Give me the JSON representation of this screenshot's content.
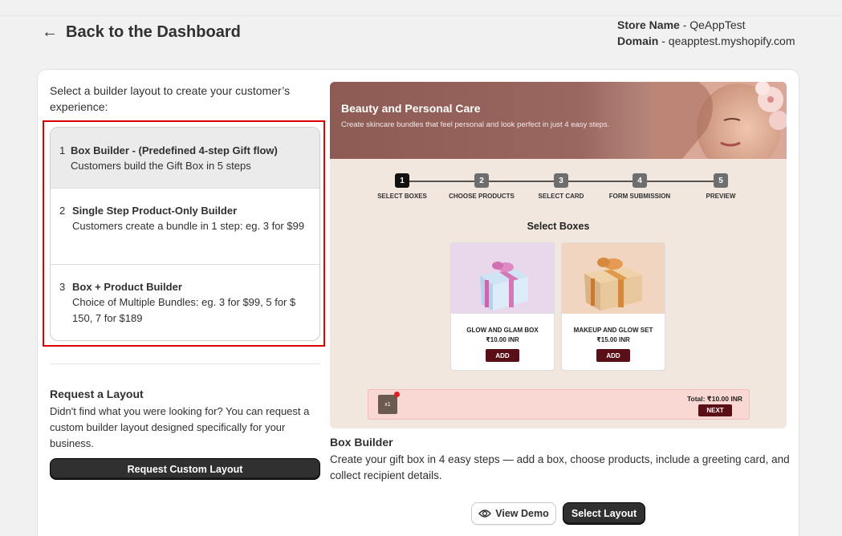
{
  "header": {
    "back_label": "Back to the Dashboard",
    "store_name_label": "Store Name",
    "store_name_value": " - QeAppTest",
    "domain_label": "Domain",
    "domain_value": " - qeapptest.myshopify.com"
  },
  "left": {
    "intro": "Select a builder layout to create your customer’s experience:",
    "options": [
      {
        "num": "1",
        "title": "Box Builder - (Predefined 4-step Gift flow)",
        "desc": "Customers build the Gift Box in 5 steps",
        "selected": true
      },
      {
        "num": "2",
        "title": "Single Step Product-Only Builder",
        "desc": "Customers create a bundle in 1 step: eg. 3 for $99",
        "selected": false
      },
      {
        "num": "3",
        "title": "Box + Product Builder",
        "desc": "Choice of Multiple Bundles: eg. 3 for $99, 5 for $ 150, 7 for $189",
        "selected": false
      }
    ],
    "request": {
      "title": "Request a Layout",
      "desc": "Didn't find what you were looking for? You can request a custom builder layout designed specifically for your business.",
      "button": "Request Custom Layout"
    }
  },
  "preview": {
    "banner_title": "Beauty and Personal Care",
    "banner_subtitle": "Create skincare bundles that feel personal and look perfect in just 4 easy steps.",
    "steps": [
      {
        "num": "1",
        "label": "SELECT BOXES",
        "active": true
      },
      {
        "num": "2",
        "label": "CHOOSE PRODUCTS",
        "active": false
      },
      {
        "num": "3",
        "label": "SELECT CARD",
        "active": false
      },
      {
        "num": "4",
        "label": "FORM SUBMISSION",
        "active": false
      },
      {
        "num": "5",
        "label": "PREVIEW",
        "active": false
      }
    ],
    "section_title": "Select Boxes",
    "products": [
      {
        "name": "GLOW AND GLAM BOX",
        "price": "₹10.00 INR",
        "button": "ADD"
      },
      {
        "name": "MAKEUP AND GLOW SET",
        "price": "₹15.00 INR",
        "button": "ADD"
      }
    ],
    "cart": {
      "qty": "x1",
      "total": "Total: ₹10.00 INR",
      "next": "NEXT"
    }
  },
  "details": {
    "title": "Box Builder",
    "desc": "Create your gift box in 4 easy steps — add a box, choose products, include a greeting card, and collect recipient details.",
    "view_demo": "View Demo",
    "select_layout": "Select Layout"
  },
  "colors": {
    "accent_dark": "#303030",
    "highlight_border": "#dd0000",
    "preview_button": "#5a0e16",
    "banner": "#8d5a54"
  },
  "icons": [
    "arrow-left-icon",
    "eye-icon"
  ]
}
